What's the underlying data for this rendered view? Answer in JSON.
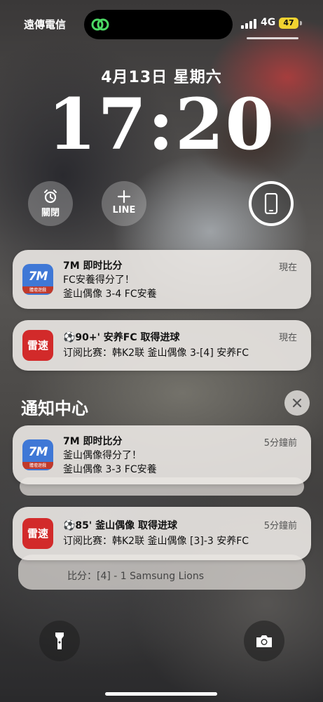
{
  "status_bar": {
    "carrier": "遠傳電信",
    "network": "4G",
    "battery": "47",
    "accent": "#f2d230"
  },
  "lockscreen": {
    "date": "4月13日 星期六",
    "time": "17:20"
  },
  "widgets": [
    {
      "label": "關閉",
      "icon": "alarm-clock-icon"
    },
    {
      "label": "LINE",
      "icon": "plus-icon"
    },
    {
      "label": "",
      "icon": "phone-icon"
    }
  ],
  "notifications": [
    {
      "app": "7M即时比分",
      "icon_text": "7M",
      "icon_sub": "體壇遊戲",
      "title": "7M 即时比分",
      "line1": "FC安養得分了！",
      "line2": "釜山偶像 3-4 FC安養",
      "when": "現在"
    },
    {
      "app": "雷速",
      "icon_text": "雷速",
      "title": "⚽90+' 安养FC 取得进球",
      "line1": "订阅比赛：韩K2联 釜山偶像 3-[4] 安养FC",
      "when": "現在"
    }
  ],
  "notification_center": {
    "title": "通知中心",
    "items": [
      {
        "icon_text": "7M",
        "icon_sub": "體壇遊戲",
        "title": "7M 即时比分",
        "line1": "釜山偶像得分了！",
        "line2": "釜山偶像 3-3 FC安養",
        "when": "5分鐘前"
      },
      {
        "icon_text": "雷速",
        "title": "⚽85' 釜山偶像 取得进球",
        "line1": "订阅比赛：韩K2联 釜山偶像 [3]-3 安养FC",
        "when": "5分鐘前"
      }
    ],
    "peek_text": "比分：[4] - 1 Samsung Lions"
  },
  "bottom": {
    "flashlight": "flashlight-icon",
    "camera": "camera-icon"
  }
}
